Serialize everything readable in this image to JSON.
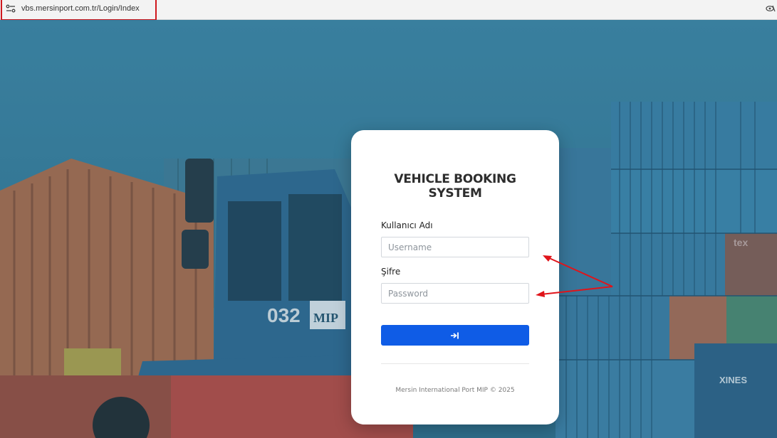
{
  "browser": {
    "url": "vbs.mersinport.com.tr/Login/Index",
    "site_info_icon": "tune-icon",
    "cookie_icon": "eye-slash-icon"
  },
  "login": {
    "title_line1": "VEHICLE BOOKING",
    "title_line2": "SYSTEM",
    "username_label": "Kullanıcı Adı",
    "username_placeholder": "Username",
    "username_value": "",
    "password_label": "Şifre",
    "password_placeholder": "Password",
    "password_value": "",
    "submit_icon": "login-arrow-icon",
    "footer": "Mersin International Port MIP © 2025"
  },
  "background": {
    "truck_number": "032",
    "truck_brand": "MIP",
    "container_text_1": "tex",
    "container_text_2": "XINES"
  },
  "colors": {
    "button": "#0f5ce6",
    "highlight_box": "#d0181e",
    "arrows": "#e0141a",
    "overlay_tint": "#2d6a86"
  }
}
